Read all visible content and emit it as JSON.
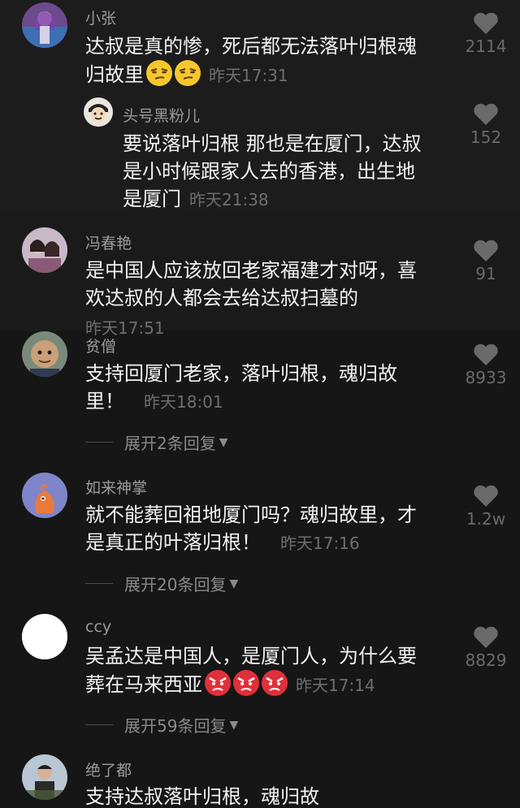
{
  "comments": [
    {
      "name": "小张",
      "line1": "达叔是真的惨，死后都无法落叶归根魂",
      "line2": "归故里",
      "time": "昨天17:31",
      "likes": "2114",
      "emoji": [
        "smirk",
        "smirk"
      ],
      "avatar_icon": "user-avatar-girl-icon"
    },
    {
      "name": "头号黑粉儿",
      "line1": "要说落叶归根 那也是在厦门，达叔",
      "line2": "是小时候跟家人去的香港，出生地",
      "line3": "是厦门",
      "time": "昨天21:38",
      "likes": "152",
      "reply": true,
      "avatar_icon": "user-avatar-cartoon-icon"
    },
    {
      "name": "冯春艳",
      "line1": "是中国人应该放回老家福建才对呀，喜",
      "line2": "欢达叔的人都会去给达叔扫墓的",
      "time": "昨天17:51",
      "likes": "91",
      "avatar_icon": "user-avatar-couple-icon"
    },
    {
      "name": "贫僧",
      "line1": "支持回厦门老家，落叶归根，魂归故",
      "line2": "里！",
      "time": "昨天18:01",
      "likes": "8933",
      "expand": "展开2条回复",
      "avatar_icon": "user-avatar-boy-icon"
    },
    {
      "name": "如来神掌",
      "line1": "就不能葬回祖地厦门吗？魂归故里，才",
      "line2": "是真正的叶落归根！",
      "time": "昨天17:16",
      "likes": "1.2w",
      "expand": "展开20条回复",
      "avatar_icon": "user-avatar-bird-icon"
    },
    {
      "name": "ccy",
      "line1": "吴孟达是中国人，是厦门人，为什么要",
      "line2": "葬在马来西亚",
      "time": "昨天17:14",
      "likes": "8829",
      "expand": "展开59条回复",
      "emoji": [
        "angry",
        "angry",
        "angry"
      ],
      "avatar_icon": "user-avatar-blank-icon"
    },
    {
      "name": "绝了都",
      "line1": "支持达叔落叶归根，魂归故",
      "avatar_icon": "user-avatar-man-icon"
    }
  ],
  "icons": {
    "like": "heart-icon",
    "expand_caret": "caret-down-icon"
  },
  "colors": {
    "background": "#161616",
    "text": "#f2f2f2",
    "muted": "#9a9a9a",
    "time": "#6e6e6e"
  }
}
